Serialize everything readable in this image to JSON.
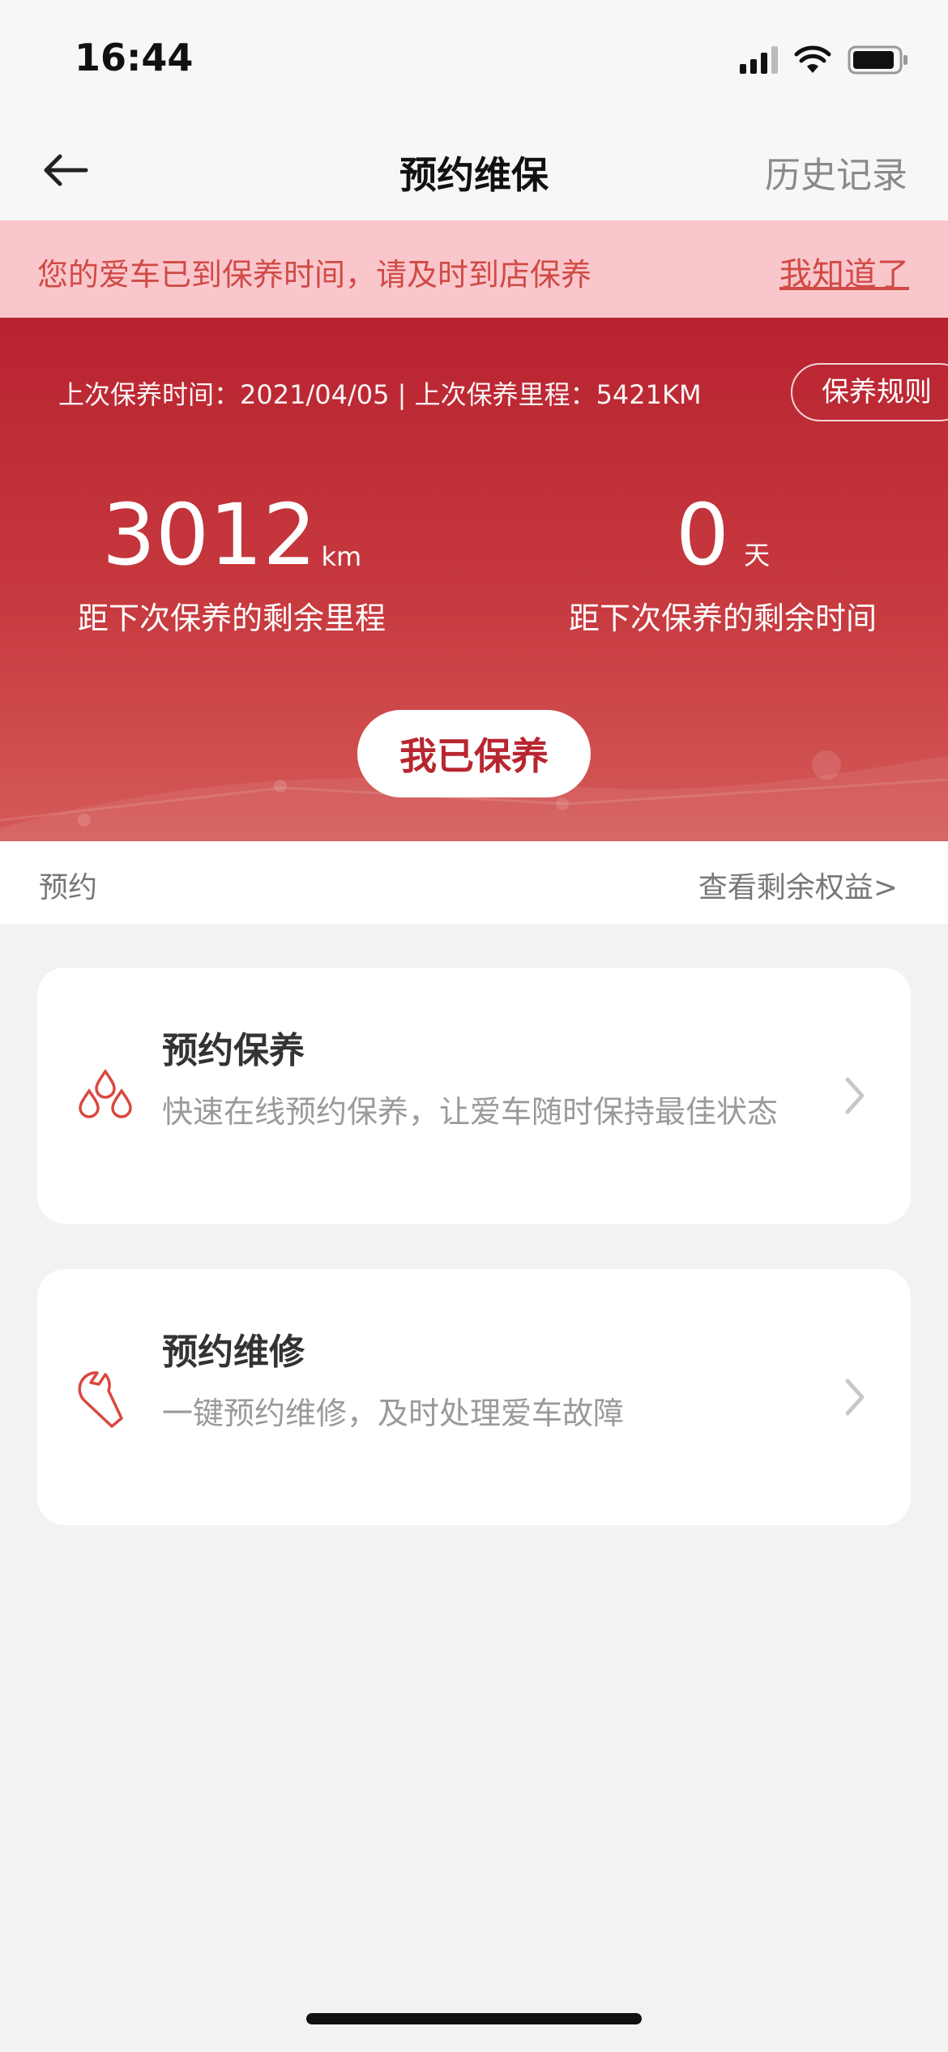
{
  "status_bar": {
    "time": "16:44"
  },
  "nav": {
    "title": "预约维保",
    "history": "历史记录"
  },
  "alert": {
    "message": "您的爱车已到保养时间，请及时到店保养",
    "dismiss": "我知道了"
  },
  "hero": {
    "info": "上次保养时间：2021/04/05 | 上次保养里程：5421KM",
    "rules_button": "保养规则",
    "mileage": {
      "value": "3012",
      "unit": "km",
      "label": "距下次保养的剩余里程"
    },
    "time_left": {
      "value": "0",
      "unit": "天",
      "label": "距下次保养的剩余时间"
    },
    "done_button": "我已保养"
  },
  "section": {
    "title": "预约",
    "benefits_link": "查看剩余权益>"
  },
  "cards": [
    {
      "icon": "water-drops-icon",
      "title": "预约保养",
      "desc": "快速在线预约保养，让爱车随时保持最佳状态"
    },
    {
      "icon": "wrench-icon",
      "title": "预约维修",
      "desc": "一键预约维修，及时处理爱车故障"
    }
  ],
  "colors": {
    "brand_red": "#b8262f",
    "alert_bg": "#f9c7cb",
    "alert_text": "#d04a46",
    "icon_red": "#d9483f"
  }
}
